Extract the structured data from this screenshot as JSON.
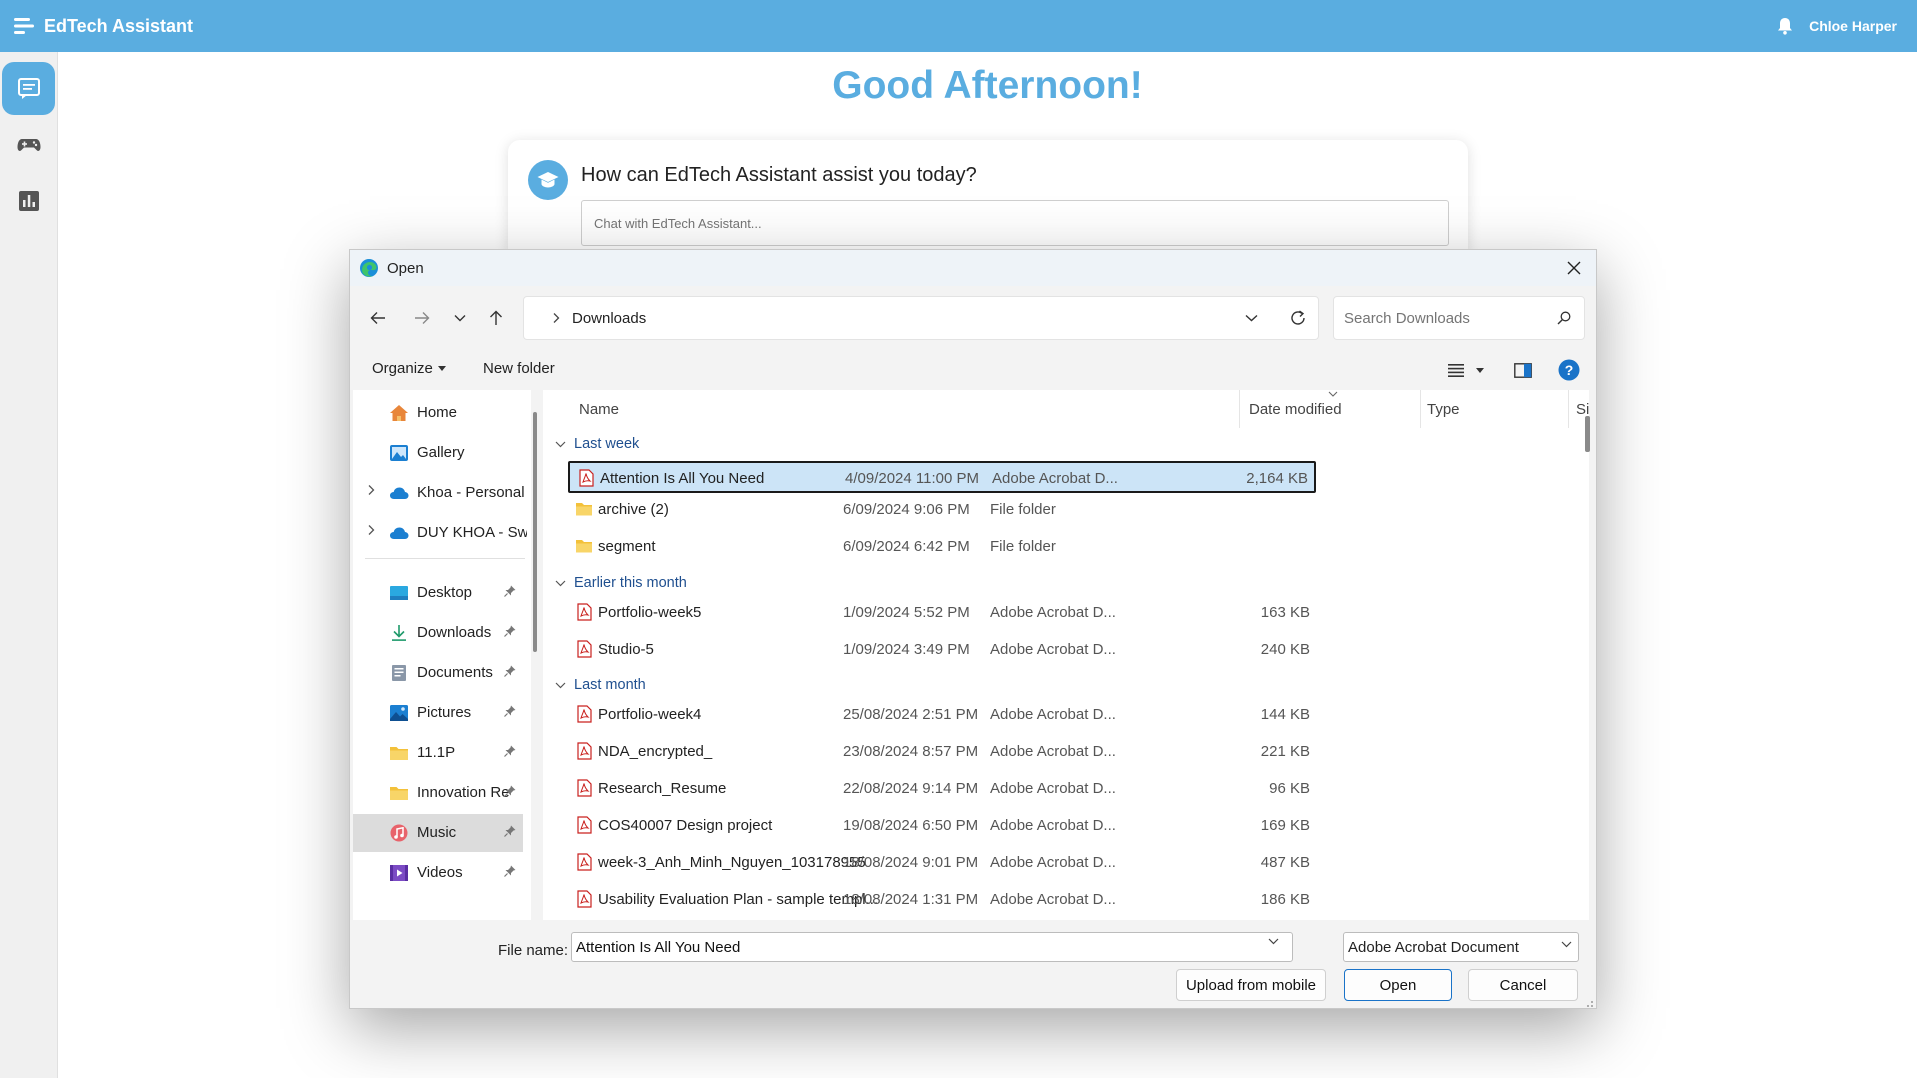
{
  "app": {
    "title": "EdTech Assistant",
    "user": "Chloe Harper",
    "accent": "#5aade0"
  },
  "main": {
    "greeting": "Good Afternoon!",
    "prompt": "How can EdTech Assistant assist you today?",
    "chat_placeholder": "Chat with EdTech Assistant..."
  },
  "dialog": {
    "title": "Open",
    "address": "Downloads",
    "search_placeholder": "Search Downloads",
    "organize": "Organize",
    "new_folder": "New folder",
    "nav": [
      {
        "label": "Home",
        "icon": "home-icon"
      },
      {
        "label": "Gallery",
        "icon": "gallery-icon"
      },
      {
        "label": "Khoa - Personal",
        "icon": "cloud-icon"
      },
      {
        "label": "DUY KHOA - Sw",
        "icon": "cloud-icon"
      },
      {
        "label": "Desktop",
        "icon": "desktop-icon"
      },
      {
        "label": "Downloads",
        "icon": "download-icon"
      },
      {
        "label": "Documents",
        "icon": "documents-icon"
      },
      {
        "label": "Pictures",
        "icon": "pictures-icon"
      },
      {
        "label": "11.1P",
        "icon": "folder-icon"
      },
      {
        "label": "Innovation Re",
        "icon": "folder-icon"
      },
      {
        "label": "Music",
        "icon": "music-icon"
      },
      {
        "label": "Videos",
        "icon": "videos-icon"
      }
    ],
    "columns": {
      "name": "Name",
      "date": "Date modified",
      "type": "Type",
      "size": "Size"
    },
    "groups": [
      "Last week",
      "Earlier this month",
      "Last month"
    ],
    "files": [
      {
        "name": "Attention Is All You Need",
        "date": "4/09/2024 11:00 PM",
        "type": "Adobe Acrobat D...",
        "size": "2,164 KB",
        "icon": "pdf-icon"
      },
      {
        "name": "archive (2)",
        "date": "6/09/2024 9:06 PM",
        "type": "File folder",
        "size": "",
        "icon": "folder-icon"
      },
      {
        "name": "segment",
        "date": "6/09/2024 6:42 PM",
        "type": "File folder",
        "size": "",
        "icon": "folder-icon"
      },
      {
        "name": "Portfolio-week5",
        "date": "1/09/2024 5:52 PM",
        "type": "Adobe Acrobat D...",
        "size": "163 KB",
        "icon": "pdf-icon"
      },
      {
        "name": "Studio-5",
        "date": "1/09/2024 3:49 PM",
        "type": "Adobe Acrobat D...",
        "size": "240 KB",
        "icon": "pdf-icon"
      },
      {
        "name": "Portfolio-week4",
        "date": "25/08/2024 2:51 PM",
        "type": "Adobe Acrobat D...",
        "size": "144 KB",
        "icon": "pdf-icon"
      },
      {
        "name": "NDA_encrypted_",
        "date": "23/08/2024 8:57 PM",
        "type": "Adobe Acrobat D...",
        "size": "221 KB",
        "icon": "pdf-icon"
      },
      {
        "name": "Research_Resume",
        "date": "22/08/2024 9:14 PM",
        "type": "Adobe Acrobat D...",
        "size": "96 KB",
        "icon": "pdf-icon"
      },
      {
        "name": "COS40007 Design project",
        "date": "19/08/2024 6:50 PM",
        "type": "Adobe Acrobat D...",
        "size": "169 KB",
        "icon": "pdf-icon"
      },
      {
        "name": "week-3_Anh_Minh_Nguyen_103178955",
        "date": "18/08/2024 9:01 PM",
        "type": "Adobe Acrobat D...",
        "size": "487 KB",
        "icon": "pdf-icon"
      },
      {
        "name": "Usability Evaluation Plan - sample templ...",
        "date": "18/08/2024 1:31 PM",
        "type": "Adobe Acrobat D...",
        "size": "186 KB",
        "icon": "pdf-icon"
      }
    ],
    "file_name_label": "File name:",
    "file_name_value": "Attention Is All You Need",
    "file_type": "Adobe Acrobat Document",
    "buttons": {
      "upload": "Upload from mobile",
      "open": "Open",
      "cancel": "Cancel"
    }
  }
}
